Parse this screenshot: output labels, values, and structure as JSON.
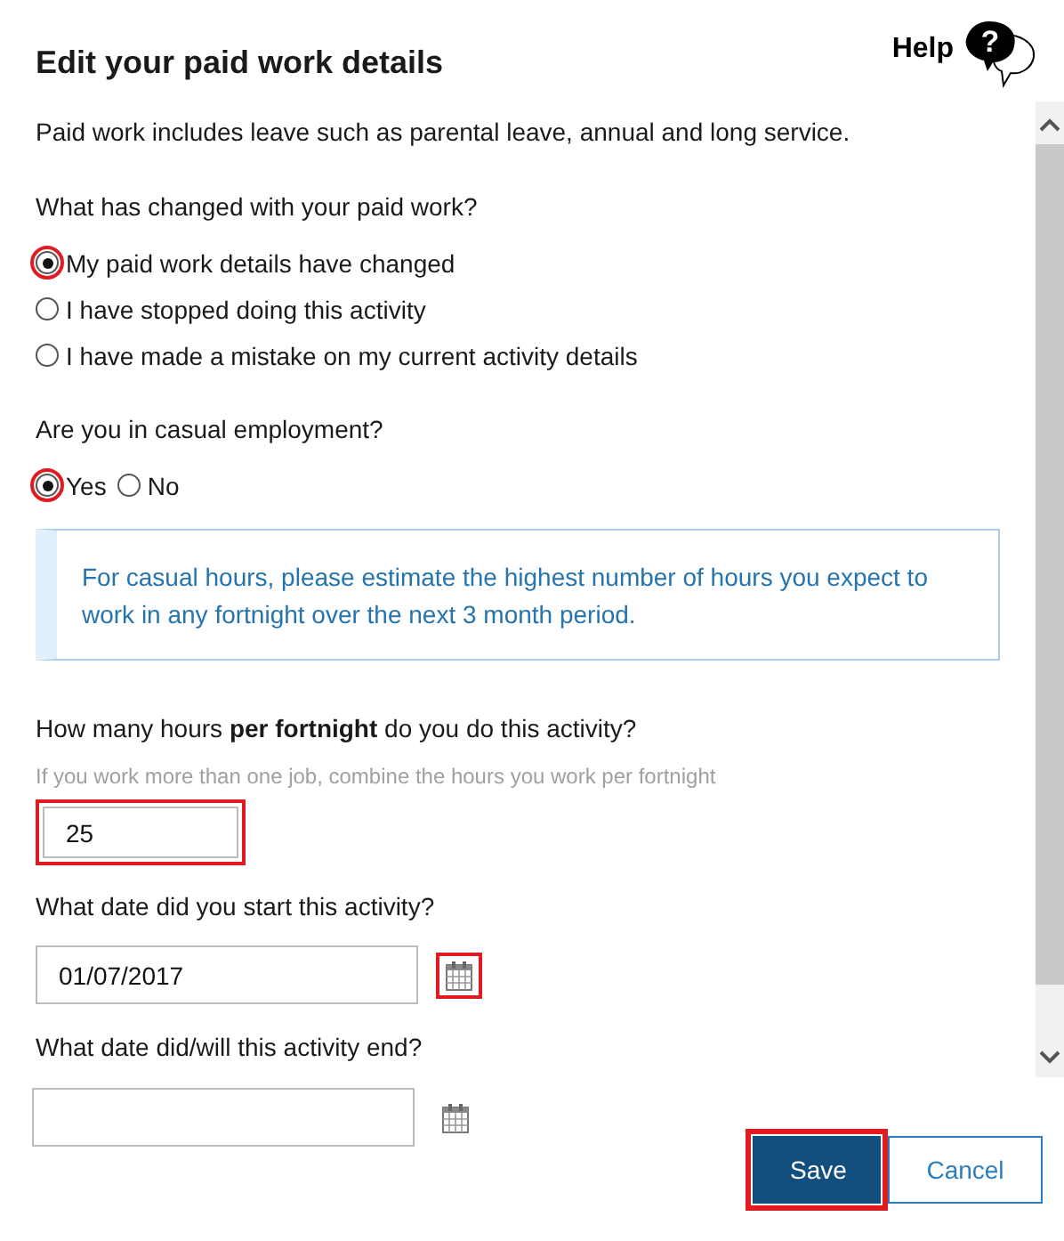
{
  "title": "Edit your paid work details",
  "help": {
    "label": "Help",
    "icon_text": "?"
  },
  "intro": "Paid work includes leave such as parental leave, annual and long service.",
  "change_question": {
    "label": "What has changed with your paid work?",
    "options": [
      {
        "label": "My paid work details have changed",
        "selected": true,
        "highlighted": true
      },
      {
        "label": "I have stopped doing this activity",
        "selected": false,
        "highlighted": false
      },
      {
        "label": "I have made a mistake on my current activity details",
        "selected": false,
        "highlighted": false
      }
    ]
  },
  "casual_question": {
    "label": "Are you in casual employment?",
    "options": [
      {
        "label": "Yes",
        "selected": true,
        "highlighted": true
      },
      {
        "label": "No",
        "selected": false,
        "highlighted": false
      }
    ]
  },
  "info_note": "For casual hours, please estimate the highest number of hours you expect to work in any fortnight over the next 3 month period.",
  "hours": {
    "label": "How many hours **per fortnight** do you do this activity?",
    "hint": "If you work more than one job, combine the hours you work per fortnight",
    "value": "25",
    "highlighted": true
  },
  "start_date": {
    "label": "What date did you start this activity?",
    "value": "01/07/2017",
    "calendar_highlighted": true
  },
  "end_date": {
    "label": "What date did/will this activity end?",
    "calendar_highlighted": false
  },
  "buttons": [
    {
      "label": "Save",
      "kind": "primary",
      "highlighted": true
    },
    {
      "label": "Cancel",
      "kind": "secondary",
      "highlighted": false
    }
  ]
}
